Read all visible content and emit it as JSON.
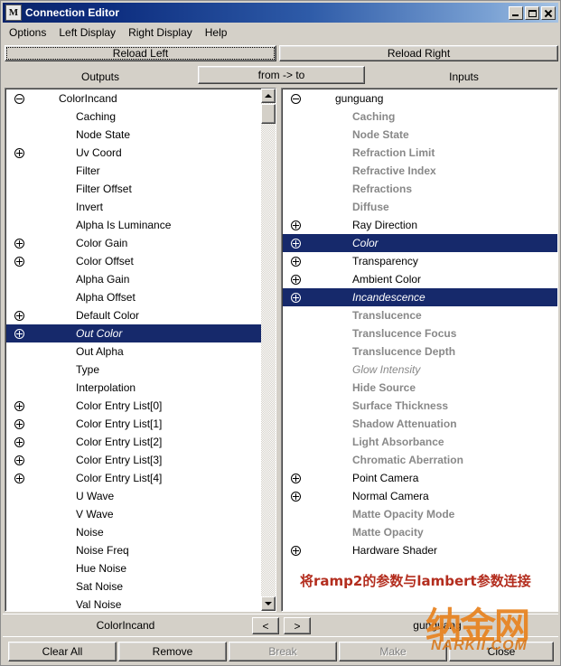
{
  "window": {
    "title": "Connection Editor",
    "icon": "maya-m-icon",
    "controls": {
      "minimize": "minimize-button",
      "maximize": "maximize-button",
      "close": "close-button"
    }
  },
  "menubar": {
    "items": [
      {
        "label": "Options"
      },
      {
        "label": "Left Display"
      },
      {
        "label": "Right Display"
      },
      {
        "label": "Help"
      }
    ]
  },
  "toolbar": {
    "reload_left": "Reload Left",
    "reload_right": "Reload Right",
    "outputs_label": "Outputs",
    "inputs_label": "Inputs",
    "from_to_label": "from -> to"
  },
  "left_panel": {
    "root": "ColorIncand",
    "items": [
      {
        "label": "ColorIncand",
        "expander": "minus",
        "root": true,
        "selected": false
      },
      {
        "label": "Caching",
        "expander": "none",
        "selected": false
      },
      {
        "label": "Node State",
        "expander": "none",
        "selected": false
      },
      {
        "label": "Uv Coord",
        "expander": "plus",
        "selected": false
      },
      {
        "label": "Filter",
        "expander": "none",
        "selected": false
      },
      {
        "label": "Filter Offset",
        "expander": "none",
        "selected": false
      },
      {
        "label": "Invert",
        "expander": "none",
        "selected": false
      },
      {
        "label": "Alpha Is Luminance",
        "expander": "none",
        "selected": false
      },
      {
        "label": "Color Gain",
        "expander": "plus",
        "selected": false
      },
      {
        "label": "Color Offset",
        "expander": "plus",
        "selected": false
      },
      {
        "label": "Alpha Gain",
        "expander": "none",
        "selected": false
      },
      {
        "label": "Alpha Offset",
        "expander": "none",
        "selected": false
      },
      {
        "label": "Default Color",
        "expander": "plus",
        "selected": false
      },
      {
        "label": "Out Color",
        "expander": "plus",
        "selected": true
      },
      {
        "label": "Out Alpha",
        "expander": "none",
        "selected": false
      },
      {
        "label": "Type",
        "expander": "none",
        "selected": false
      },
      {
        "label": "Interpolation",
        "expander": "none",
        "selected": false
      },
      {
        "label": "Color Entry List[0]",
        "expander": "plus",
        "selected": false
      },
      {
        "label": "Color Entry List[1]",
        "expander": "plus",
        "selected": false
      },
      {
        "label": "Color Entry List[2]",
        "expander": "plus",
        "selected": false
      },
      {
        "label": "Color Entry List[3]",
        "expander": "plus",
        "selected": false
      },
      {
        "label": "Color Entry List[4]",
        "expander": "plus",
        "selected": false
      },
      {
        "label": "U Wave",
        "expander": "none",
        "selected": false
      },
      {
        "label": "V Wave",
        "expander": "none",
        "selected": false
      },
      {
        "label": "Noise",
        "expander": "none",
        "selected": false
      },
      {
        "label": "Noise Freq",
        "expander": "none",
        "selected": false
      },
      {
        "label": "Hue Noise",
        "expander": "none",
        "selected": false
      },
      {
        "label": "Sat Noise",
        "expander": "none",
        "selected": false
      },
      {
        "label": "Val Noise",
        "expander": "none",
        "selected": false
      }
    ],
    "scrollbar": {
      "up": "scroll-up-arrow",
      "down": "scroll-down-arrow",
      "thumb": "scroll-thumb"
    }
  },
  "right_panel": {
    "root": "gunguang",
    "items": [
      {
        "label": "gunguang",
        "expander": "minus",
        "root": true,
        "state": "normal",
        "selected": false
      },
      {
        "label": "Caching",
        "expander": "none",
        "state": "dim",
        "selected": false
      },
      {
        "label": "Node State",
        "expander": "none",
        "state": "dim",
        "selected": false
      },
      {
        "label": "Refraction Limit",
        "expander": "none",
        "state": "dim",
        "selected": false
      },
      {
        "label": "Refractive Index",
        "expander": "none",
        "state": "dim",
        "selected": false
      },
      {
        "label": "Refractions",
        "expander": "none",
        "state": "dim",
        "selected": false
      },
      {
        "label": "Diffuse",
        "expander": "none",
        "state": "dim",
        "selected": false
      },
      {
        "label": "Ray Direction",
        "expander": "plus",
        "state": "normal",
        "selected": false
      },
      {
        "label": "Color",
        "expander": "plus",
        "state": "normal",
        "selected": true
      },
      {
        "label": "Transparency",
        "expander": "plus",
        "state": "normal",
        "selected": false
      },
      {
        "label": "Ambient Color",
        "expander": "plus",
        "state": "normal",
        "selected": false
      },
      {
        "label": "Incandescence",
        "expander": "plus",
        "state": "normal",
        "selected": true
      },
      {
        "label": "Translucence",
        "expander": "none",
        "state": "dim",
        "selected": false
      },
      {
        "label": "Translucence Focus",
        "expander": "none",
        "state": "dim",
        "selected": false
      },
      {
        "label": "Translucence Depth",
        "expander": "none",
        "state": "dim",
        "selected": false
      },
      {
        "label": "Glow Intensity",
        "expander": "none",
        "state": "dim-italic",
        "selected": false
      },
      {
        "label": "Hide Source",
        "expander": "none",
        "state": "dim",
        "selected": false
      },
      {
        "label": "Surface Thickness",
        "expander": "none",
        "state": "dim",
        "selected": false
      },
      {
        "label": "Shadow Attenuation",
        "expander": "none",
        "state": "dim",
        "selected": false
      },
      {
        "label": "Light Absorbance",
        "expander": "none",
        "state": "dim",
        "selected": false
      },
      {
        "label": "Chromatic Aberration",
        "expander": "none",
        "state": "dim",
        "selected": false
      },
      {
        "label": "Point Camera",
        "expander": "plus",
        "state": "normal",
        "selected": false
      },
      {
        "label": "Normal Camera",
        "expander": "plus",
        "state": "normal",
        "selected": false
      },
      {
        "label": "Matte Opacity Mode",
        "expander": "none",
        "state": "dim",
        "selected": false
      },
      {
        "label": "Matte Opacity",
        "expander": "none",
        "state": "dim",
        "selected": false
      },
      {
        "label": "Hardware Shader",
        "expander": "plus",
        "state": "normal",
        "selected": false
      }
    ],
    "annotation": "将ramp2的参数与lambert参数连接"
  },
  "bottom_bar": {
    "left_node": "ColorIncand",
    "right_node": "gunguang",
    "prev_label": "<",
    "next_label": ">"
  },
  "actions": [
    {
      "label": "Clear All",
      "disabled": false
    },
    {
      "label": "Remove",
      "disabled": false
    },
    {
      "label": "Break",
      "disabled": true
    },
    {
      "label": "Make",
      "disabled": true
    },
    {
      "label": "Close",
      "disabled": false
    }
  ],
  "watermark": {
    "cn": "纳金网",
    "en": "NARKII.COM"
  },
  "colors": {
    "selection": "#16296b",
    "chrome": "#d4d0c8",
    "titlebar_start": "#0a246a",
    "annotation": "#b32d1e",
    "watermark": "#e8821e",
    "dim_text": "#888888"
  }
}
